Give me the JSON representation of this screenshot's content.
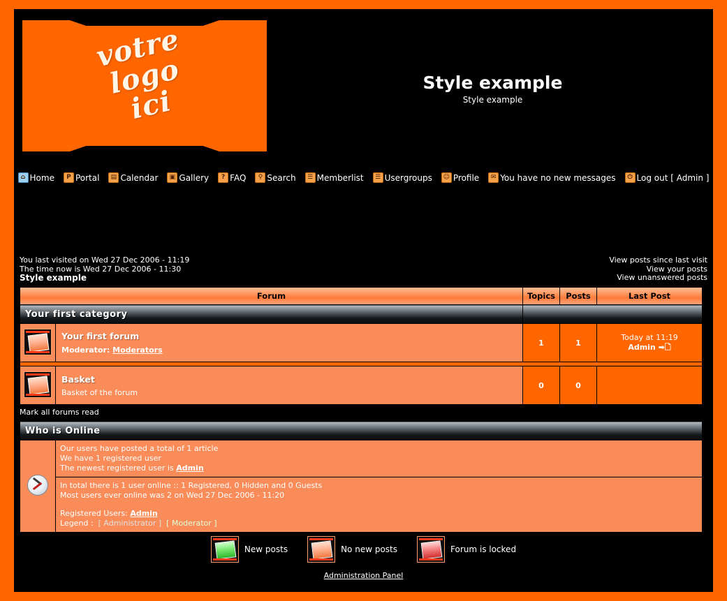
{
  "logo": {
    "line1": "votre",
    "line2": "logo",
    "line3": "ici"
  },
  "site": {
    "title": "Style example",
    "description": "Style example"
  },
  "nav": [
    {
      "label": "Home",
      "icon": "home-icon",
      "glyph": "⌂"
    },
    {
      "label": "Portal",
      "icon": "portal-icon",
      "glyph": "P"
    },
    {
      "label": "Calendar",
      "icon": "calendar-icon",
      "glyph": "▤"
    },
    {
      "label": "Gallery",
      "icon": "gallery-icon",
      "glyph": "▣"
    },
    {
      "label": "FAQ",
      "icon": "faq-icon",
      "glyph": "?"
    },
    {
      "label": "Search",
      "icon": "search-icon",
      "glyph": "⚲"
    },
    {
      "label": "Memberlist",
      "icon": "memberlist-icon",
      "glyph": "☰"
    },
    {
      "label": "Usergroups",
      "icon": "usergroups-icon",
      "glyph": "☰"
    },
    {
      "label": "Profile",
      "icon": "profile-icon",
      "glyph": "☺"
    },
    {
      "label": "You have no new messages",
      "icon": "messages-icon",
      "glyph": "✉"
    },
    {
      "label": "Log out [ Admin ]",
      "icon": "logout-icon",
      "glyph": "⏻"
    }
  ],
  "visit": {
    "last_visited": "You last visited on Wed 27 Dec 2006 - 11:19",
    "time_now": "The time now is Wed 27 Dec 2006 - 11:30",
    "board_name": "Style example",
    "links": [
      "View posts since last visit",
      "View your posts",
      "View unanswered posts"
    ]
  },
  "forum_table": {
    "columns": {
      "forum": "Forum",
      "topics": "Topics",
      "posts": "Posts",
      "last_post": "Last Post"
    },
    "categories": [
      {
        "name": "Your first category",
        "forums": [
          {
            "name": "Your first forum",
            "description": "",
            "moderator_label": "Moderator:",
            "moderator_link": "Moderators",
            "topics": "1",
            "posts": "1",
            "last_post_time": "Today at 11:19",
            "last_post_user": "Admin",
            "icon": "no-new-posts-icon"
          },
          {
            "name": "Basket",
            "description": "Basket of the forum",
            "moderator_label": "",
            "moderator_link": "",
            "topics": "0",
            "posts": "0",
            "last_post_time": "",
            "last_post_user": "",
            "icon": "no-new-posts-icon"
          }
        ]
      }
    ]
  },
  "mark_all_read": "Mark all forums read",
  "who_is_online": {
    "title": "Who is Online",
    "stats": [
      "Our users have posted a total of 1 article",
      "We have 1 registered user",
      "The newest registered user is Admin"
    ],
    "newest_user": "Admin",
    "online_line1": "In total there is 1 user online :: 1 Registered, 0 Hidden and 0 Guests",
    "online_line2": "Most users ever online was 2 on Wed 27 Dec 2006 - 11:20",
    "registered_label": "Registered Users:",
    "registered_users": "Admin",
    "legend_label": "Legend :",
    "legend_admin": "[ Administrator ]",
    "legend_mod": "[ Moderator ]"
  },
  "bottom_legend": [
    {
      "label": "New posts",
      "icon": "new-posts-icon",
      "style": "green"
    },
    {
      "label": "No new posts",
      "icon": "no-new-posts-icon",
      "style": "orange"
    },
    {
      "label": "Forum is locked",
      "icon": "locked-forum-icon",
      "style": "red"
    }
  ],
  "admin_panel": "Administration Panel",
  "colors": {
    "page_border": "#FF6600",
    "background": "#000000",
    "accent_orange": "#FF6600",
    "row_salmon": "#FA8C5A",
    "header_gradient_top": "#FFB98E",
    "text_white": "#FFFFFF"
  }
}
